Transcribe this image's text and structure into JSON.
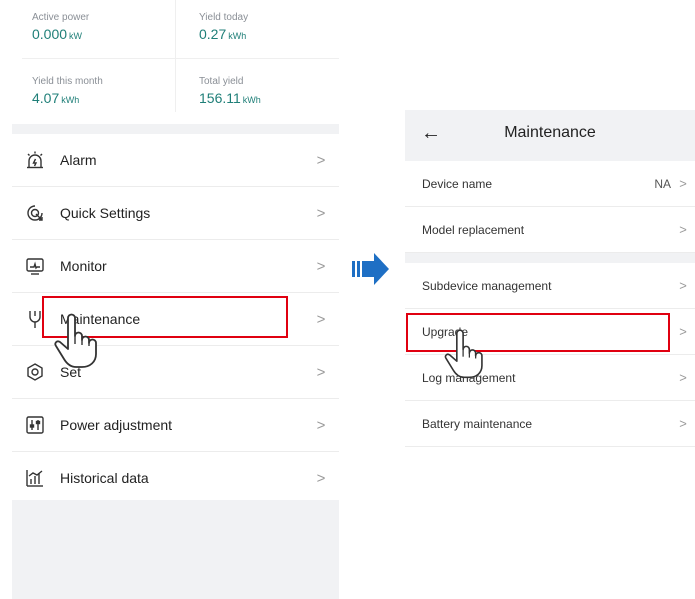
{
  "stats": {
    "active_power": {
      "label": "Active power",
      "value": "0.000",
      "unit": "kW"
    },
    "yield_today": {
      "label": "Yield today",
      "value": "0.27",
      "unit": "kWh"
    },
    "yield_month": {
      "label": "Yield this month",
      "value": "4.07",
      "unit": "kWh"
    },
    "total_yield": {
      "label": "Total yield",
      "value": "156.11",
      "unit": "kWh"
    }
  },
  "menu": {
    "items": [
      {
        "label": "Alarm",
        "icon": "alarm-icon"
      },
      {
        "label": "Quick Settings",
        "icon": "quick-settings-icon"
      },
      {
        "label": "Monitor",
        "icon": "monitor-icon"
      },
      {
        "label": "Maintenance",
        "icon": "maintenance-icon"
      },
      {
        "label": "Set",
        "icon": "settings-icon"
      },
      {
        "label": "Power adjustment",
        "icon": "power-adjustment-icon"
      },
      {
        "label": "Historical data",
        "icon": "historical-data-icon"
      }
    ],
    "chevron": ">"
  },
  "maintenance": {
    "title": "Maintenance",
    "back_icon": "←",
    "device_name": {
      "label": "Device name",
      "value": "NA"
    },
    "model_replacement": "Model replacement",
    "subdevice_management": "Subdevice management",
    "upgrade": "Upgrade",
    "log_management": "Log management",
    "battery_maintenance": "Battery maintenance",
    "chevron": ">"
  },
  "colors": {
    "accent_teal": "#1f7f78",
    "highlight_red": "#e00010",
    "arrow_blue": "#1e6fc4",
    "panel_gray": "#f1f2f4"
  }
}
